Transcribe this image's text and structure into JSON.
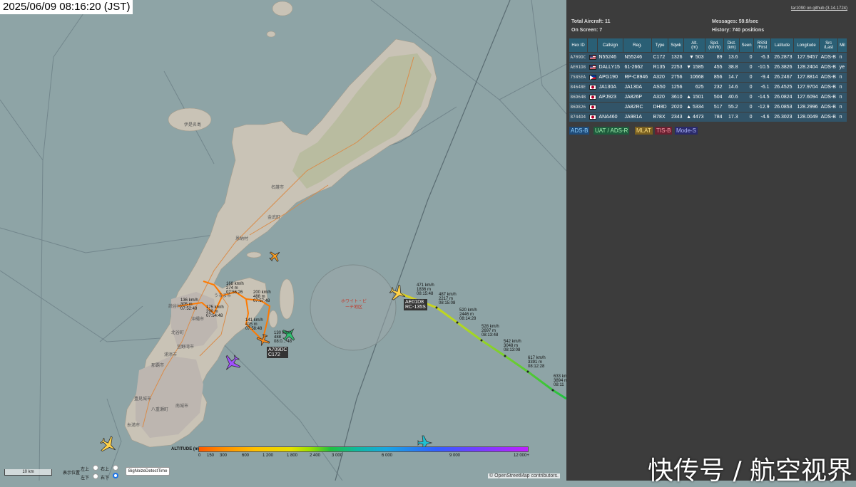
{
  "clock": "2025/06/09 08:16:20 (JST)",
  "map": {
    "place_labels": [
      "名護市",
      "伊是名島",
      "沖縄市",
      "うるま市",
      "那覇市",
      "南城市",
      "豊見城市",
      "糸満市",
      "八重瀬町",
      "浦添市",
      "宜野湾市",
      "北谷町",
      "読谷村",
      "恩納村",
      "金武町"
    ],
    "zone_label": "ホワイト・ビーチ地区",
    "aircraft_labels": {
      "ae01d8": [
        "AE01D8",
        "RC-135S"
      ],
      "a709dc": [
        "A709DC",
        "C172"
      ]
    },
    "track_labels": [
      "471 km/h\n1836 m\n08:15:48",
      "487 km/h\n2217 m\n08:15:08",
      "520 km/h\n2446 m\n08:14:28",
      "528 km/h\n2697 m\n08:13:48",
      "542 km/h\n3048 m\n08:13:08",
      "617 km/h\n3391 m\n08:12:28",
      "633 km/h\n3894 m\n08:11",
      "168 km/h\n274 m\n07:56:26",
      "200 km/h\n488 m\n07:57:48",
      "136 km/h\n305 m\n07:52:49",
      "175 km/h\n290 m\n07:54:48",
      "141 km/h\n415 m\n07:58:48",
      "130 km/h\n488\n08:0... 48"
    ],
    "legend": {
      "title": "ALTITUDE (m)",
      "ticks": [
        "0",
        "150",
        "300",
        "600",
        "1 200",
        "1 800",
        "2 400",
        "3 000",
        "6 000",
        "9 000",
        "12 000+"
      ]
    },
    "scale": "10 km",
    "controls": {
      "label_left": "表示位置",
      "opts": [
        "左上",
        "右上",
        "左下",
        "右下"
      ],
      "button": "BigNoizeDetectTime"
    },
    "credit": "© OpenStreetMap contributors.",
    "watermark": "快传号 / 航空视界"
  },
  "panel": {
    "version": "tar1090 on github (3.14.1724)",
    "total_label": "Total Aircraft: 11",
    "onscreen_label": "On Screen: 7",
    "messages_label": "Messages: 59.9/sec",
    "history_label": "History: 740 positions",
    "columns": [
      "Hex ID",
      "",
      "Callsign",
      "Reg.",
      "Type",
      "Sqwk",
      "Alt.\n(m)",
      "Spd.\n(km/h)",
      "Dist.\n(km)",
      "Seen",
      "RSSI\n/First",
      "Latitude",
      "Longitude",
      "Src\n/Last",
      "Mil"
    ],
    "rows": [
      {
        "hex": "A709DC",
        "flag": "us",
        "callsign": "N55246",
        "reg": "N55246",
        "type": "C172",
        "sqwk": "1326",
        "alt": "▼ 503",
        "spd": "89",
        "dist": "13.6",
        "seen": "0",
        "rssi": "-6.3",
        "lat": "26.2873",
        "lon": "127.9457",
        "src": "ADS-B",
        "mil": "n"
      },
      {
        "hex": "AE01D8",
        "flag": "us",
        "callsign": "DALLY15",
        "reg": "61-2662",
        "type": "R135",
        "sqwk": "2253",
        "alt": "▼ 1585",
        "spd": "455",
        "dist": "38.8",
        "seen": "0",
        "rssi": "-10.5",
        "lat": "26.3826",
        "lon": "128.2404",
        "src": "ADS-B",
        "mil": "ye"
      },
      {
        "hex": "7585EA",
        "flag": "ph",
        "callsign": "APG190",
        "reg": "RP-C8946",
        "type": "A320",
        "sqwk": "2756",
        "alt": "10668",
        "spd": "856",
        "dist": "14.7",
        "seen": "0",
        "rssi": "-9.4",
        "lat": "26.2467",
        "lon": "127.8814",
        "src": "ADS-B",
        "mil": "n"
      },
      {
        "hex": "84648E",
        "flag": "jp",
        "callsign": "JA130A",
        "reg": "JA130A",
        "type": "AS50",
        "sqwk": "1256",
        "alt": "625",
        "spd": "232",
        "dist": "14.6",
        "seen": "0",
        "rssi": "-6.1",
        "lat": "26.4525",
        "lon": "127.9704",
        "src": "ADS-B",
        "mil": "n"
      },
      {
        "hex": "86D64B",
        "flag": "jp",
        "callsign": "APJ923",
        "reg": "JA826P",
        "type": "A320",
        "sqwk": "3610",
        "alt": "▲ 1501",
        "spd": "504",
        "dist": "40.6",
        "seen": "0",
        "rssi": "-14.5",
        "lat": "26.0824",
        "lon": "127.6094",
        "src": "ADS-B",
        "mil": "n"
      },
      {
        "hex": "86D826",
        "flag": "jp",
        "callsign": "",
        "reg": "JA82RC",
        "type": "DH8D",
        "sqwk": "2020",
        "alt": "▲ 5334",
        "spd": "517",
        "dist": "55.2",
        "seen": "0",
        "rssi": "-12.9",
        "lat": "26.0853",
        "lon": "128.2996",
        "src": "ADS-B",
        "mil": "n"
      },
      {
        "hex": "8744D4",
        "flag": "jp",
        "callsign": "ANA460",
        "reg": "JA981A",
        "type": "B78X",
        "sqwk": "2343",
        "alt": "▲ 4473",
        "spd": "784",
        "dist": "17.3",
        "seen": "0",
        "rssi": "-4.6",
        "lat": "26.3023",
        "lon": "128.0049",
        "src": "ADS-B",
        "mil": "n"
      }
    ],
    "sources": [
      {
        "label": "ADS-B",
        "bg": "#1f4b78",
        "fg": "#8fd0ff"
      },
      {
        "label": "UAT / ADS-R",
        "bg": "#1e5c3c",
        "fg": "#a0f0b0"
      },
      {
        "label": "MLAT",
        "bg": "#7a6020",
        "fg": "#ffe080"
      },
      {
        "label": "TIS-B",
        "bg": "#6a2030",
        "fg": "#ff9aa8"
      },
      {
        "label": "Mode-S",
        "bg": "#2a2a6a",
        "fg": "#b0b8ff"
      }
    ]
  }
}
